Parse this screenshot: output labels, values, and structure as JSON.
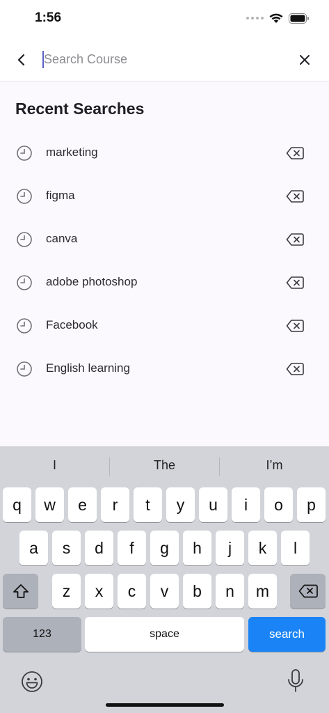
{
  "status_bar": {
    "time": "1:56"
  },
  "search": {
    "placeholder": "Search Course",
    "value": ""
  },
  "recent": {
    "title": "Recent Searches",
    "items": [
      {
        "label": "marketing"
      },
      {
        "label": "figma"
      },
      {
        "label": "canva"
      },
      {
        "label": "adobe photoshop"
      },
      {
        "label": "Facebook"
      },
      {
        "label": "English learning"
      }
    ]
  },
  "keyboard": {
    "suggestions": [
      "I",
      "The",
      "I’m"
    ],
    "row1": [
      "q",
      "w",
      "e",
      "r",
      "t",
      "y",
      "u",
      "i",
      "o",
      "p"
    ],
    "row2": [
      "a",
      "s",
      "d",
      "f",
      "g",
      "h",
      "j",
      "k",
      "l"
    ],
    "row3": [
      "z",
      "x",
      "c",
      "v",
      "b",
      "n",
      "m"
    ],
    "numbers_label": "123",
    "space_label": "space",
    "search_label": "search"
  },
  "colors": {
    "accent": "#1a84f6",
    "caret": "#5b5fc7"
  }
}
